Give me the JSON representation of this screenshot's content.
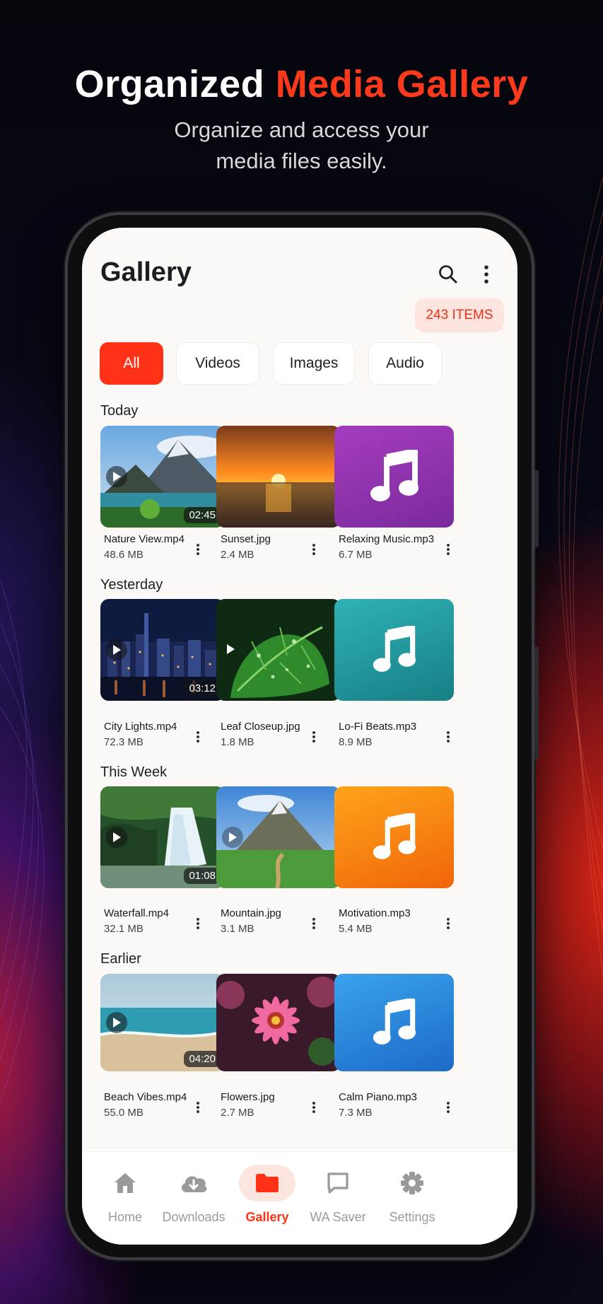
{
  "hero": {
    "title_part1": "Organized ",
    "title_part2": "Media Gallery",
    "subtitle_line1": "Organize and access your",
    "subtitle_line2": "media files easily."
  },
  "app": {
    "title": "Gallery",
    "search_icon": "search-icon",
    "menu_icon": "more-vertical-icon",
    "items_badge": "243 ITEMS",
    "accent_color": "#ff3218"
  },
  "filters": [
    {
      "label": "All",
      "active": true
    },
    {
      "label": "Videos",
      "active": false
    },
    {
      "label": "Images",
      "active": false
    },
    {
      "label": "Audio",
      "active": false
    }
  ],
  "sections": [
    {
      "label": "Today",
      "items": [
        {
          "name": "Nature View.mp4",
          "size": "48.6 MB",
          "kind": "video",
          "duration": "02:45"
        },
        {
          "name": "Sunset.jpg",
          "size": "2.4 MB",
          "kind": "image"
        },
        {
          "name": "Relaxing Music.mp3",
          "size": "6.7 MB",
          "kind": "audio",
          "color": "#8e2fb0"
        }
      ]
    },
    {
      "label": "Yesterday",
      "items": [
        {
          "name": "City Lights.mp4",
          "size": "72.3 MB",
          "kind": "video",
          "duration": "03:12"
        },
        {
          "name": "Leaf Closeup.jpg",
          "size": "1.8 MB",
          "kind": "image"
        },
        {
          "name": "Lo-Fi Beats.mp3",
          "size": "8.9 MB",
          "kind": "audio",
          "color": "#1e9aa0"
        }
      ]
    },
    {
      "label": "This Week",
      "items": [
        {
          "name": "Waterfall.mp4",
          "size": "32.1 MB",
          "kind": "video",
          "duration": "01:08"
        },
        {
          "name": "Mountain.jpg",
          "size": "3.1 MB",
          "kind": "image"
        },
        {
          "name": "Motivation.mp3",
          "size": "5.4 MB",
          "kind": "audio",
          "color": "#f7780c"
        }
      ]
    },
    {
      "label": "Earlier",
      "items": [
        {
          "name": "Beach Vibes.mp4",
          "size": "55.0 MB",
          "kind": "video",
          "duration": "04:20"
        },
        {
          "name": "Flowers.jpg",
          "size": "2.7 MB",
          "kind": "image"
        },
        {
          "name": "Calm Piano.mp3",
          "size": "7.3 MB",
          "kind": "audio",
          "color": "#2f86dc"
        }
      ]
    }
  ],
  "nav": [
    {
      "label": "Home",
      "icon": "home-icon",
      "active": false
    },
    {
      "label": "Downloads",
      "icon": "cloud-download-icon",
      "active": false
    },
    {
      "label": "Gallery",
      "icon": "folder-icon",
      "active": true
    },
    {
      "label": "WA Saver",
      "icon": "chat-icon",
      "active": false
    },
    {
      "label": "Settings",
      "icon": "gear-icon",
      "active": false
    }
  ]
}
